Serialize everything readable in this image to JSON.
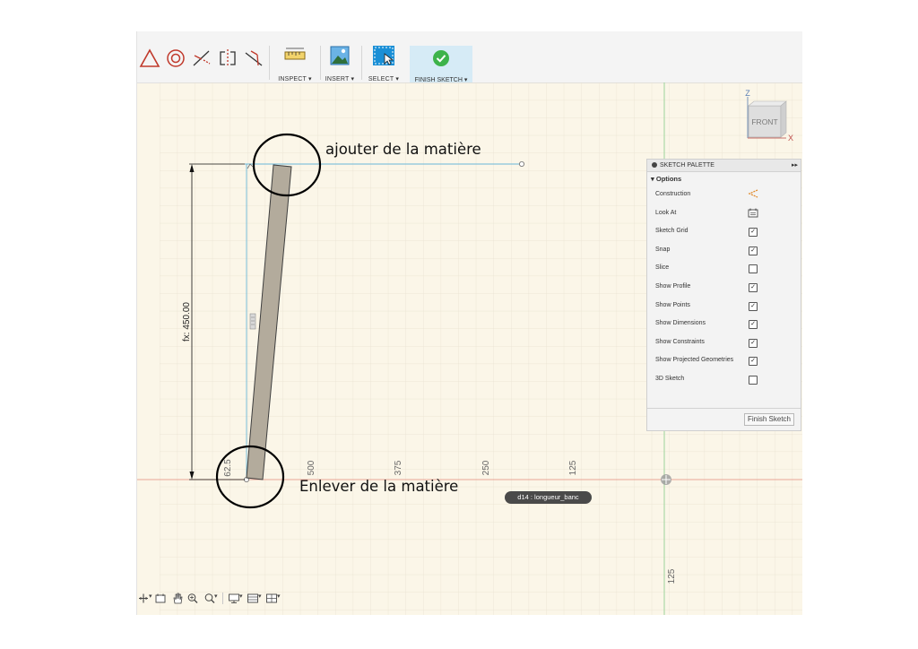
{
  "toolbar": {
    "sketch_tools": [
      "triangle-icon",
      "circle-icon",
      "trim-icon",
      "mirror-icon",
      "extend-icon"
    ],
    "inspect_label": "INSPECT",
    "insert_label": "INSERT",
    "select_label": "SELECT",
    "finish_label": "FINISH SKETCH"
  },
  "viewcube": {
    "face": "FRONT",
    "axis_z": "Z",
    "axis_x": "X"
  },
  "dimension": {
    "vertical": "fx: 450.00"
  },
  "ruler_labels": [
    "62.5",
    "500",
    "375",
    "250",
    "125"
  ],
  "vertical_ruler_label": "125",
  "annotations": {
    "top": "ajouter de la matière",
    "bottom": "Enlever de la matière"
  },
  "tooltip": "d14 : longueur_banc",
  "palette": {
    "title": "SKETCH PALETTE",
    "section": "Options",
    "rows": [
      {
        "label": "Construction",
        "control": "construction-icon"
      },
      {
        "label": "Look At",
        "control": "look-at-icon"
      },
      {
        "label": "Sketch Grid",
        "checked": true
      },
      {
        "label": "Snap",
        "checked": true
      },
      {
        "label": "Slice",
        "checked": false
      },
      {
        "label": "Show Profile",
        "checked": true
      },
      {
        "label": "Show Points",
        "checked": true
      },
      {
        "label": "Show Dimensions",
        "checked": true
      },
      {
        "label": "Show Constraints",
        "checked": true
      },
      {
        "label": "Show Projected Geometries",
        "checked": true
      },
      {
        "label": "3D Sketch",
        "checked": false
      }
    ],
    "finish_button": "Finish Sketch"
  },
  "colors": {
    "canvas_bg": "#fbf6e8",
    "grid": "#e6e0cf",
    "x_axis": "#e07a6a",
    "y_axis": "#8fd08f",
    "accent": "#2f7fb6",
    "finish_green": "#3db34a",
    "bar_fill": "#b3ab9c"
  }
}
